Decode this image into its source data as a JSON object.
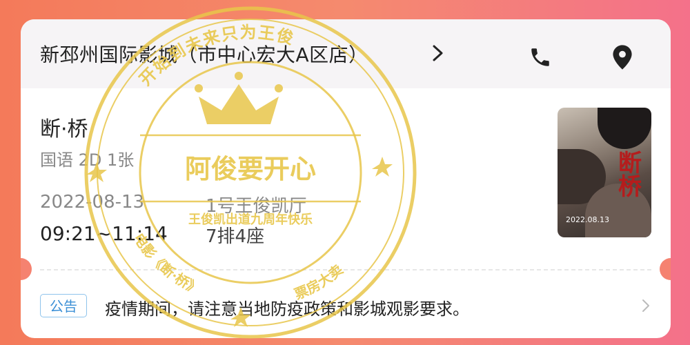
{
  "cinema": {
    "name": "新邳州国际影城（市中心宏大A区店）"
  },
  "ticket": {
    "movie_title": "断·桥",
    "meta": "国语 2D 1张",
    "date": "2022-08-13",
    "hall": "1号王俊凯厅",
    "time": "09:21~11:14",
    "seat": "7排4座"
  },
  "poster": {
    "title": "断桥",
    "date": "2022.08.13"
  },
  "notice": {
    "badge": "公告",
    "text": "疫情期间，请注意当地防疫政策和影城观影要求。"
  },
  "stamp": {
    "top_arc": "开始到未来只为王俊",
    "center": "阿俊要开心",
    "subtitle": "王俊凯出道九周年快乐",
    "bottom_left": "电影《断·桥》",
    "bottom_right": "票房大卖"
  },
  "colors": {
    "background_left": "#f47a5a",
    "background_right": "#f4718a",
    "stamp": "#e8c64a",
    "notice_blue": "#3a8fd6"
  },
  "icons": {
    "cinema_chevron": "chevron-right-icon",
    "phone": "phone-icon",
    "location": "location-pin-icon",
    "notice_chevron": "chevron-right-icon"
  }
}
